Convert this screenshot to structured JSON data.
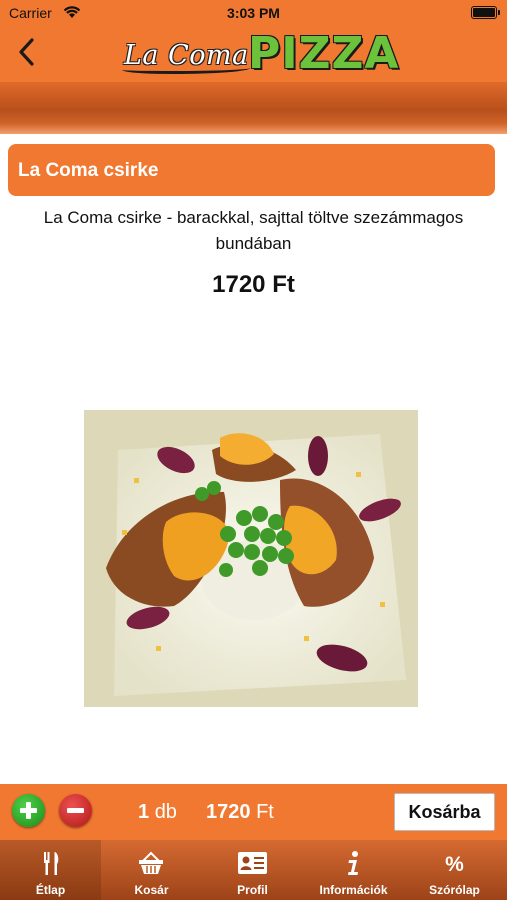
{
  "status_bar": {
    "carrier": "Carrier",
    "time": "3:03 PM"
  },
  "header": {
    "logo_script": "La Coma",
    "logo_main": "PIZZA"
  },
  "product": {
    "name": "La Coma csirke",
    "description": "La Coma csirke - barackkal, sajttal töltve szezámmagos bundában",
    "price": "1720 Ft"
  },
  "order": {
    "quantity": "1",
    "quantity_unit": "db",
    "total_value": "1720",
    "total_currency": "Ft",
    "cart_button": "Kosárba"
  },
  "tabs": [
    {
      "label": "Étlap",
      "icon": "fork-knife-icon",
      "active": true
    },
    {
      "label": "Kosár",
      "icon": "basket-icon",
      "active": false
    },
    {
      "label": "Profil",
      "icon": "id-card-icon",
      "active": false
    },
    {
      "label": "Információk",
      "icon": "info-icon",
      "active": false
    },
    {
      "label": "Szórólap",
      "icon": "percent-icon",
      "active": false
    }
  ],
  "colors": {
    "brand_orange": "#f07830",
    "tab_dark": "#9c4318",
    "logo_green": "#6cc23a"
  }
}
